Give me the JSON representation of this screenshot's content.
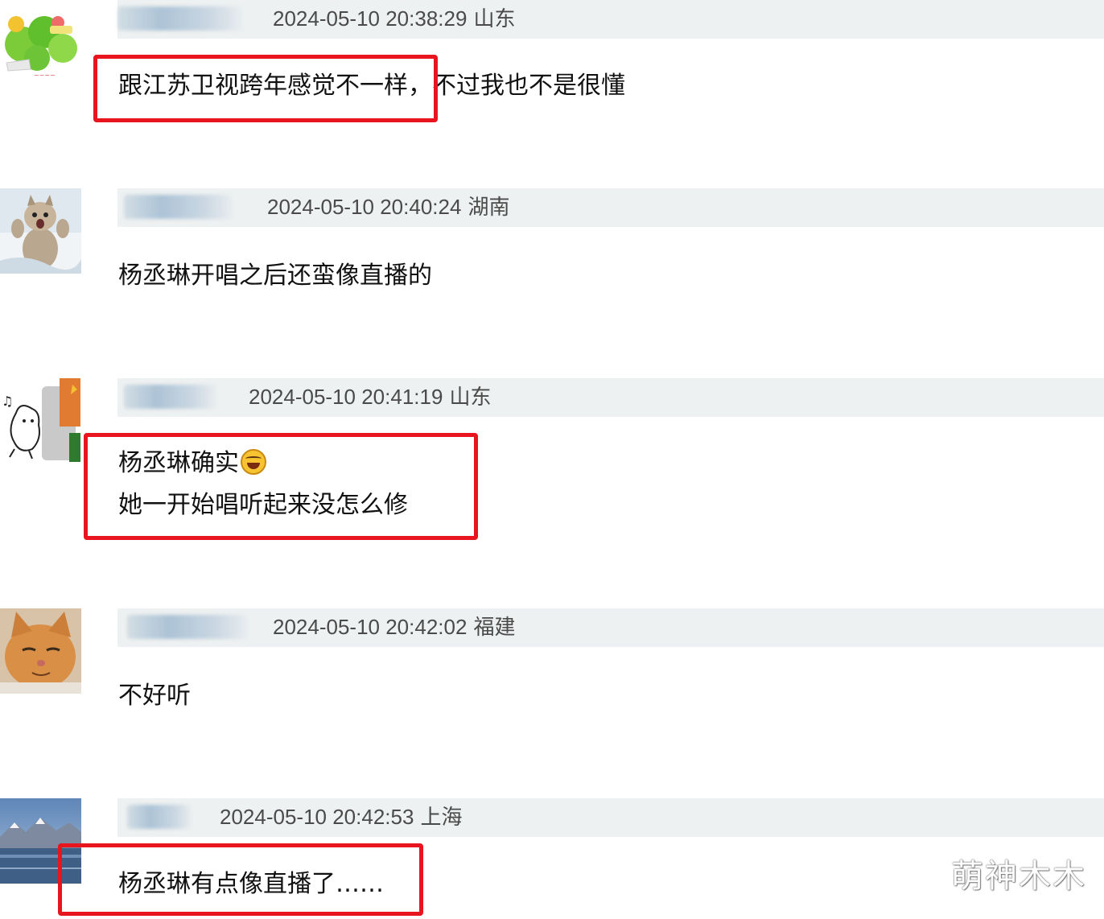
{
  "comments": [
    {
      "meta": {
        "time": "2024-05-10 20:38:29",
        "location": "山东"
      },
      "lines": [
        "跟江苏卫视跨年感觉不一样，不过我也不是很懂"
      ],
      "avatar": "green-sticker-avatar",
      "highlighted": true
    },
    {
      "meta": {
        "time": "2024-05-10 20:40:24",
        "location": "湖南"
      },
      "lines": [
        "杨丞琳开唱之后还蛮像直播的"
      ],
      "avatar": "cat-avatar",
      "highlighted": false
    },
    {
      "meta": {
        "time": "2024-05-10 20:41:19",
        "location": "山东"
      },
      "lines": [
        "杨丞琳确实",
        "她一开始唱听起来没怎么修"
      ],
      "emoji": "laughing-tears-emoji",
      "avatar": "doodle-avatar",
      "highlighted": true
    },
    {
      "meta": {
        "time": "2024-05-10 20:42:02",
        "location": "福建"
      },
      "lines": [
        "不好听"
      ],
      "avatar": "orange-cat-avatar",
      "highlighted": false
    },
    {
      "meta": {
        "time": "2024-05-10 20:42:53",
        "location": "上海"
      },
      "lines": [
        "杨丞琳有点像直播了……"
      ],
      "avatar": "mountain-lake-avatar",
      "highlighted": true
    }
  ],
  "watermark": "萌神木木",
  "colors": {
    "highlight": "#e8141e",
    "header_bar": "#eef1f1",
    "meta_text": "#4a4a4a"
  }
}
